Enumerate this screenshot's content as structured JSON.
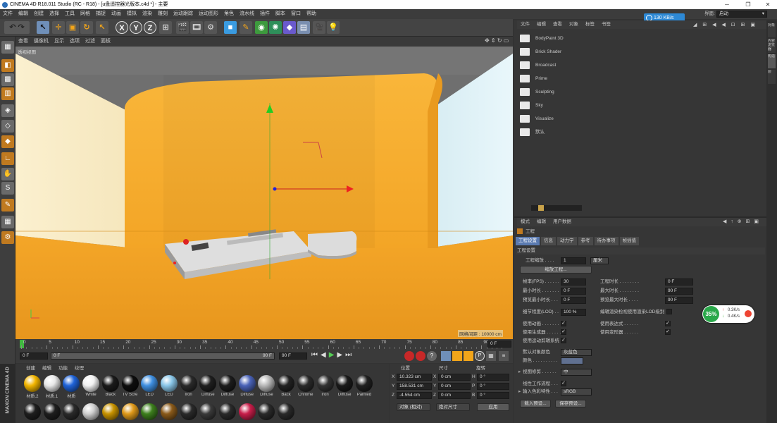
{
  "window": {
    "title": "CINEMA 4D R18.011 Studio (RC - R18) - [u盘遥控器光版本.c4d *] - 主要",
    "controls": [
      "─",
      "❐",
      "✕"
    ]
  },
  "menu": [
    "文件",
    "编辑",
    "创建",
    "选择",
    "工具",
    "网格",
    "捕捉",
    "动画",
    "模拟",
    "渲染",
    "雕刻",
    "运动跟踪",
    "运动图形",
    "角色",
    "流水线",
    "插件",
    "脚本",
    "窗口",
    "帮助"
  ],
  "network": {
    "speed": "130 KB/s"
  },
  "layout": {
    "label": "界面:",
    "value": "启动"
  },
  "toolbar": {
    "x": "X",
    "y": "Y",
    "z": "Z"
  },
  "viewport": {
    "menu": [
      "查看",
      "摄像机",
      "显示",
      "选项",
      "过滤",
      "面板"
    ],
    "label": "透视视图",
    "grid_info": "网格间距 : 10000 cm"
  },
  "timeline": {
    "ticks": [
      "0",
      "5",
      "10",
      "15",
      "20",
      "25",
      "30",
      "35",
      "40",
      "45",
      "50",
      "55",
      "60",
      "65",
      "70",
      "75",
      "80",
      "85",
      "90"
    ],
    "current_frame": "0 F"
  },
  "playback": {
    "start": "0 F",
    "slider_start": "0 F",
    "slider_end": "90 F",
    "end": "90 F"
  },
  "material_manager": {
    "menu": [
      "创建",
      "编辑",
      "功能",
      "纹理"
    ],
    "materials": [
      {
        "name": "材质.2",
        "color": "#f2b500"
      },
      {
        "name": "材质.1",
        "color": "#e8e8e8"
      },
      {
        "name": "材质",
        "color": "#1f63d8"
      },
      {
        "name": "White",
        "color": "#f2f2f2"
      },
      {
        "name": "Black",
        "color": "#1a1a1a"
      },
      {
        "name": "TV Scre",
        "color": "#0d0d0d"
      },
      {
        "name": "LED",
        "color": "#3f8fe0"
      },
      {
        "name": "LED",
        "color": "#89c6e8"
      },
      {
        "name": "Iron",
        "color": "#2a2a2a"
      },
      {
        "name": "Diffuse",
        "color": "#1f1f1f"
      },
      {
        "name": "Diffuse",
        "color": "#1c1c1c"
      },
      {
        "name": "Diffuse",
        "color": "#4a63b8"
      },
      {
        "name": "Diffuse",
        "color": "#b8b8b8"
      },
      {
        "name": "Back",
        "color": "#222222"
      },
      {
        "name": "Chrome",
        "color": "#2a2a2a"
      },
      {
        "name": "Iron",
        "color": "#333333"
      },
      {
        "name": "Diffuse",
        "color": "#1a1a1a"
      },
      {
        "name": "Painted",
        "color": "#202020"
      }
    ],
    "row2_colors": [
      "#1e1e1e",
      "#1e1e1e",
      "#2a2a2a",
      "#d0d0d0",
      "#c89300",
      "#e09a1a",
      "#3d7f1d",
      "#8a5a1a",
      "#2a2a2a",
      "#3a3a3a",
      "#2a2a2a",
      "#c81e4a",
      "#2a2a2a",
      "#2a2a2a"
    ]
  },
  "coordinates": {
    "headers": {
      "position": "位置",
      "size": "尺寸",
      "rotation": "旋转"
    },
    "rows": [
      {
        "axis": "X",
        "pos": "10.323 cm",
        "saxis": "X",
        "size": "0 cm",
        "raxis": "H",
        "rot": "0 °"
      },
      {
        "axis": "Y",
        "pos": "158.531 cm",
        "saxis": "Y",
        "size": "0 cm",
        "raxis": "P",
        "rot": "0 °"
      },
      {
        "axis": "Z",
        "pos": "-4.554 cm",
        "saxis": "Z",
        "size": "0 cm",
        "raxis": "B",
        "rot": "0 °"
      }
    ],
    "mode1": "对象 (相对)",
    "mode2": "绝对尺寸",
    "apply": "应用"
  },
  "object_manager": {
    "menu": [
      "文件",
      "编辑",
      "查看",
      "对象",
      "标签",
      "书签"
    ],
    "items": [
      "BodyPaint 3D",
      "Brick Shader",
      "Broadcast",
      "Prime",
      "Sculpting",
      "Sky",
      "Visualize",
      "默认"
    ]
  },
  "side_tabs": [
    "对象",
    "内容浏览器",
    "构造",
    "层"
  ],
  "attributes": {
    "menu": [
      "模式",
      "编辑",
      "用户数据"
    ],
    "object": "工程",
    "tabs": [
      "工程设置",
      "信息",
      "动力学",
      "参考",
      "待办事项",
      "帧插值"
    ],
    "section": "工程设置",
    "scale_label": "工程缩放 . . . .",
    "scale_value": "1",
    "scale_unit": "厘米",
    "scale_button": "缩放工程...",
    "fields_left": [
      {
        "label": "帧率(FPS) . . . . . .",
        "value": "30"
      },
      {
        "label": "最小时长 . . . . . . .",
        "value": "0 F"
      },
      {
        "label": "预览最小时长 . . .",
        "value": "0 F"
      }
    ],
    "fields_right": [
      {
        "label": "工程时长 . . . . . . . .",
        "value": "0 F"
      },
      {
        "label": "最大时长 . . . . . . . .",
        "value": "90 F"
      },
      {
        "label": "预览最大时长 . . . .",
        "value": "90 F"
      }
    ],
    "lod_label": "细节程度(LOD) . .",
    "lod_value": "100 %",
    "lod_right": "编辑渲染检视使用渲染LOD级别",
    "checks_left": [
      "使用动画 . . . . . . .",
      "使用生成器 . . . . . .",
      "使用运动剪辑系统"
    ],
    "checks_right": [
      "使用表达式 . . . . . .",
      "使用变形器 . . . . . ."
    ],
    "default_color_label": "默认对象颜色",
    "default_color_value": "灰蓝色",
    "color_label": "颜色 . . . . . . . . . .",
    "clip_label": "视图修剪 . . . . . .",
    "clip_value": "中",
    "linear_label": "线性工作流程 . . .",
    "input_color_label": "输入色彩特性 . . .",
    "input_color_value": "sRGB",
    "load_preset": "载入预设...",
    "save_preset": "保存预设..."
  },
  "sysmon": {
    "percent": "35%",
    "up": "0.3K/s",
    "down": "0.4K/s"
  },
  "brand": {
    "line1": "MAXON",
    "line2": "CINEMA 4D"
  }
}
